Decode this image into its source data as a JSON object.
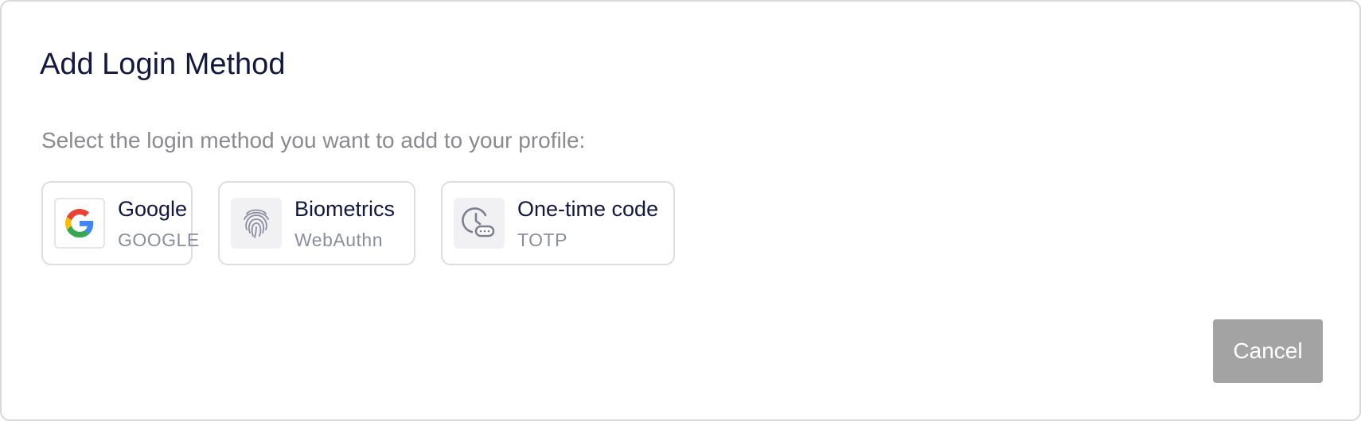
{
  "dialog": {
    "title": "Add Login Method",
    "subtitle": "Select the login method you want to add to your profile:",
    "methods": [
      {
        "name": "Google",
        "type": "GOOGLE",
        "icon": "google-icon"
      },
      {
        "name": "Biometrics",
        "type": "WebAuthn",
        "icon": "fingerprint-icon"
      },
      {
        "name": "One-time code",
        "type": "TOTP",
        "icon": "clock-code-icon"
      }
    ],
    "cancel_label": "Cancel"
  },
  "colors": {
    "title": "#13183f",
    "subtitle": "#8a8a8f",
    "card_border": "#dedee2",
    "secondary_text": "#8c8e9e",
    "cancel_bg": "#a3a3a3",
    "google_blue": "#4285F4",
    "google_red": "#EA4335",
    "google_yellow": "#FBBC05",
    "google_green": "#34A853"
  }
}
